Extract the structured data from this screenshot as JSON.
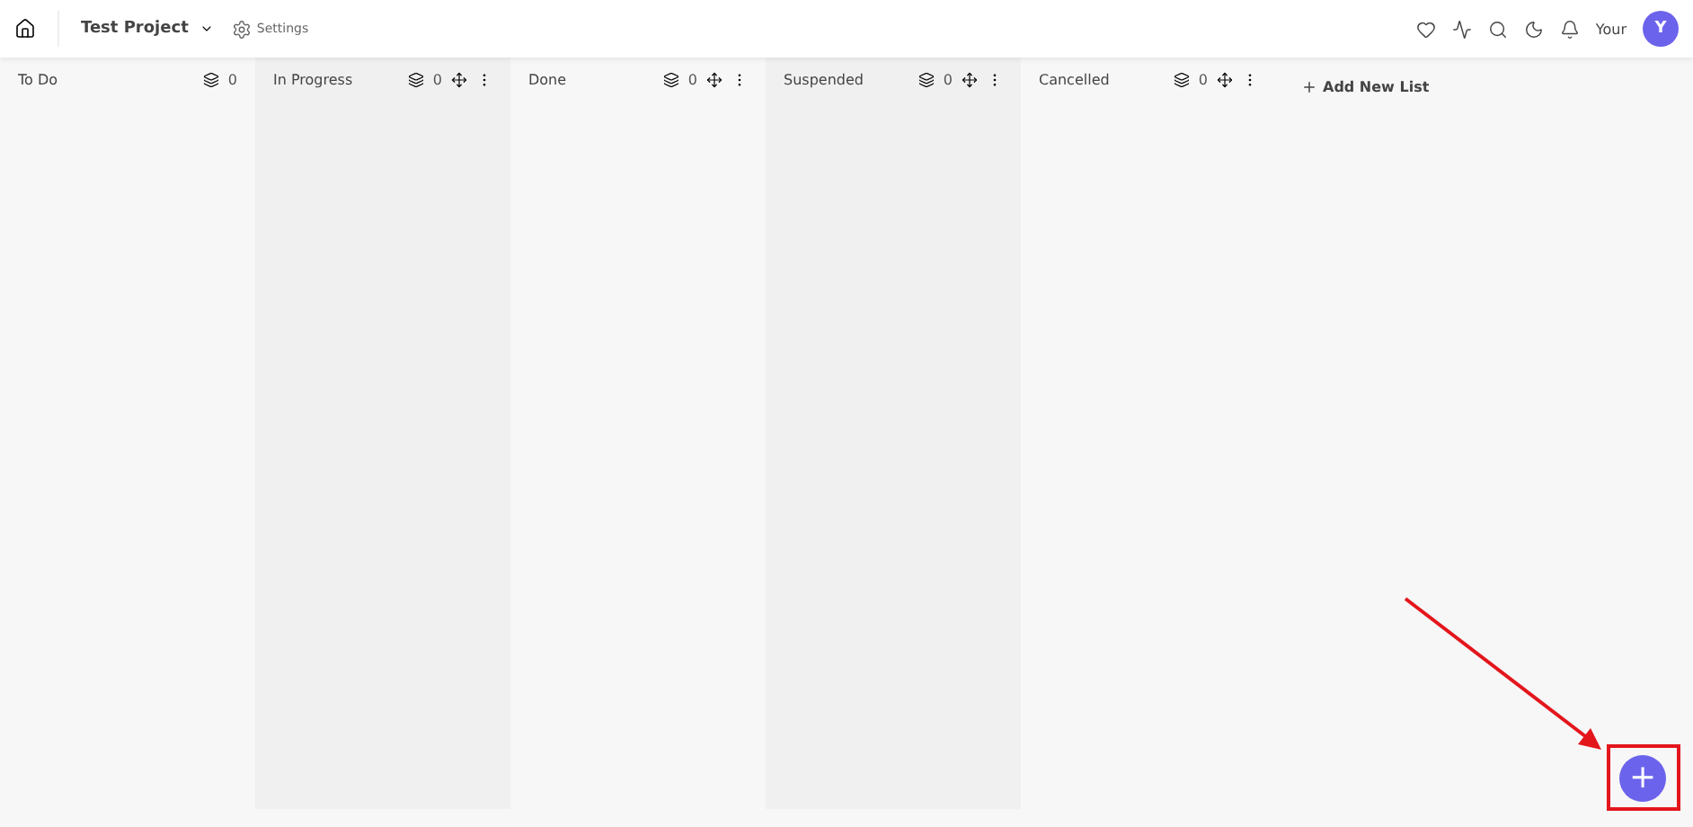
{
  "header": {
    "project": "Test Project",
    "settings": "Settings",
    "user": "Your",
    "avatar": "Y"
  },
  "lists": [
    {
      "name": "To Do",
      "count": "0",
      "movable": false
    },
    {
      "name": "In Progress",
      "count": "0",
      "movable": true
    },
    {
      "name": "Done",
      "count": "0",
      "movable": true
    },
    {
      "name": "Suspended",
      "count": "0",
      "movable": true
    },
    {
      "name": "Cancelled",
      "count": "0",
      "movable": true
    }
  ],
  "add_list": "Add New List",
  "fab": "+"
}
